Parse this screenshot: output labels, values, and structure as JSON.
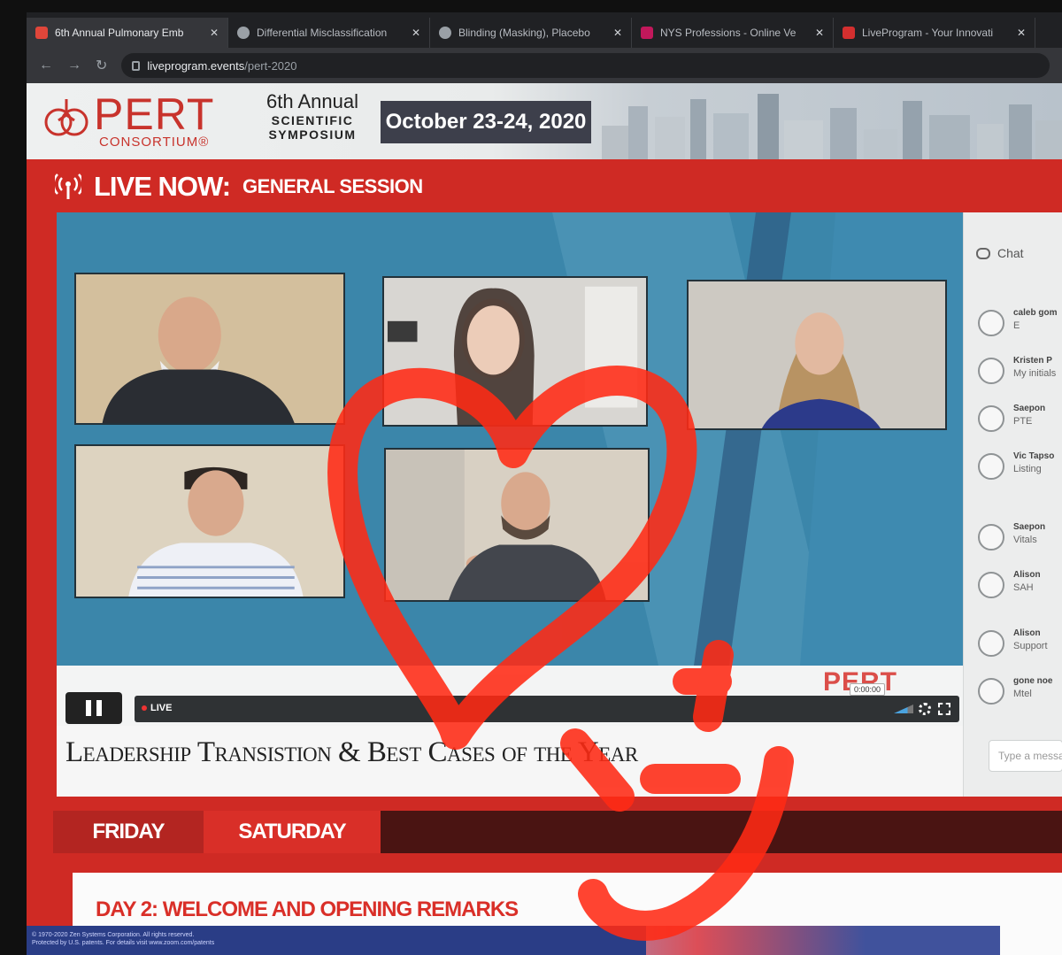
{
  "browser": {
    "tabs": [
      {
        "title": "6th Annual Pulmonary Emb",
        "active": true,
        "favicon_color": "#e0463a"
      },
      {
        "title": "Differential Misclassification",
        "active": false,
        "favicon_color": "#9aa0a6"
      },
      {
        "title": "Blinding (Masking), Placebo",
        "active": false,
        "favicon_color": "#9aa0a6"
      },
      {
        "title": "NYS Professions - Online Ve",
        "active": false,
        "favicon_color": "#c2185b"
      },
      {
        "title": "LiveProgram - Your Innovati",
        "active": false,
        "favicon_color": "#d32f2f"
      }
    ],
    "url_host": "liveprogram.events",
    "url_path": "/pert-2020"
  },
  "banner": {
    "logo_text": "PERT",
    "logo_sub": "CONSORTIUM®",
    "annual_line1": "6th Annual",
    "annual_line2": "SCIENTIFIC",
    "annual_line3": "SYMPOSIUM",
    "dates": "October 23-24, 2020"
  },
  "live": {
    "label": "LIVE NOW:",
    "session": "GENERAL SESSION"
  },
  "player": {
    "live_badge": "LIVE",
    "time": "0:00:00",
    "watermark": "PERT",
    "video_title": "Leadership Transistion & Best Cases of the Year"
  },
  "chat": {
    "title": "Chat",
    "input_placeholder": "Type a message",
    "messages": [
      {
        "name": "caleb gom",
        "text": "E"
      },
      {
        "name": "Kristen P",
        "text": "My initials"
      },
      {
        "name": "Saepon",
        "text": "PTE"
      },
      {
        "name": "Vic Tapso",
        "text": "Listing"
      },
      {
        "name": "Saepon",
        "text": "Vitals"
      },
      {
        "name": "Alison",
        "text": "SAH"
      },
      {
        "name": "Alison",
        "text": "Support"
      },
      {
        "name": "gone noe",
        "text": "Mtel"
      }
    ]
  },
  "schedule": {
    "days": [
      "FRIDAY",
      "SATURDAY"
    ],
    "active_day": "SATURDAY",
    "first_item": "DAY 2: WELCOME AND OPENING REMARKS"
  },
  "footer": {
    "line1": "© 1970-2020 Zen Systems Corporation. All rights reserved.",
    "line2": "Protected by U.S. patents. For details visit www.zoom.com/patents"
  },
  "colors": {
    "page_red": "#cf2a24",
    "stage_blue": "#3b86aa",
    "doodle": "#ff2a14"
  }
}
